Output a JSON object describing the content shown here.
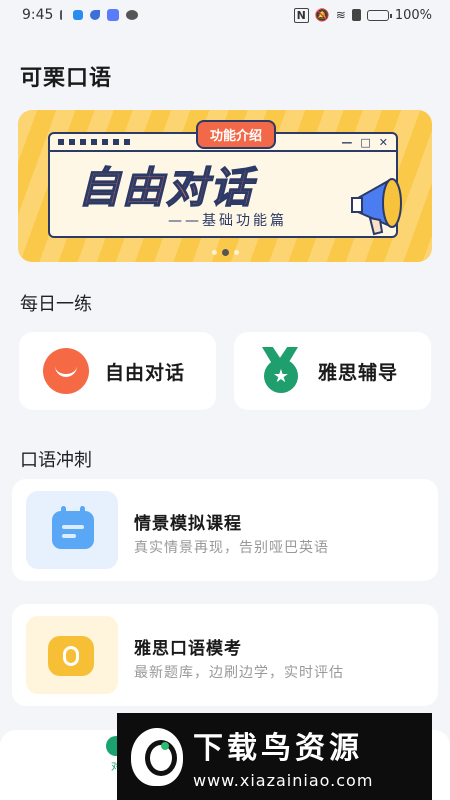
{
  "status_bar": {
    "time": "9:45",
    "battery": "100%"
  },
  "app": {
    "title": "可栗口语"
  },
  "banner": {
    "tag": "功能介绍",
    "headline": "自由对话",
    "subtitle": "——基础功能篇",
    "page_count": 3,
    "active_page": 2
  },
  "daily_practice": {
    "title": "每日一练",
    "items": [
      {
        "label": "自由对话",
        "icon": "smile-face-icon",
        "color": "#f56a45"
      },
      {
        "label": "雅思辅导",
        "icon": "medal-star-icon",
        "color": "#1f9e6e"
      }
    ]
  },
  "oral_sprint": {
    "title": "口语冲刺",
    "courses": [
      {
        "title": "情景模拟课程",
        "subtitle": "真实情景再现，告别哑巴英语",
        "icon": "calendar-icon",
        "bg": "#e6f1fd"
      },
      {
        "title": "雅思口语模考",
        "subtitle": "最新题库，边刷边学，实时评估",
        "icon": "microphone-bubble-icon",
        "bg": "#fff4dc"
      }
    ]
  },
  "tabbar": {
    "visible_label": "对"
  },
  "watermark": {
    "title": "下载鸟资源",
    "url": "www.xiazainiao.com"
  },
  "colors": {
    "accent_green": "#1aa36f",
    "banner_yellow": "#fbc94a",
    "banner_orange": "#f2694a"
  }
}
